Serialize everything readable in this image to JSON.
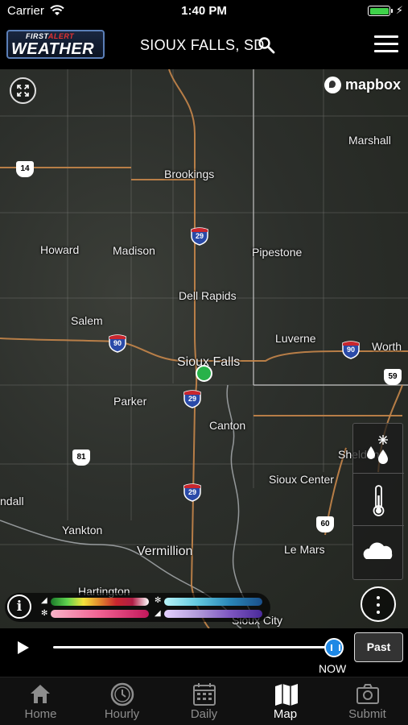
{
  "status": {
    "carrier": "Carrier",
    "time": "1:40 PM"
  },
  "header": {
    "logo_top_first": "FIRST",
    "logo_top_alert": "ALERT",
    "logo_main": "WEATHER",
    "location": "SIOUX FALLS, SD",
    "search_icon": "search-icon",
    "menu_icon": "hamburger-menu-icon"
  },
  "map": {
    "attribution": "mapbox",
    "fullscreen_icon": "fullscreen-icon",
    "cities": {
      "marshall": "Marshall",
      "brookings": "Brookings",
      "howard": "Howard",
      "madison": "Madison",
      "pipestone": "Pipestone",
      "dell_rapids": "Dell Rapids",
      "salem": "Salem",
      "luverne": "Luverne",
      "worthington": "Worth",
      "sioux_falls": "Sioux Falls",
      "parker": "Parker",
      "canton": "Canton",
      "sheldon": "Sheldon",
      "sioux_center": "Sioux Center",
      "randall": "ndall",
      "yankton": "Yankton",
      "le_mars": "Le Mars",
      "vermillion": "Vermillion",
      "hartington": "Hartington",
      "sioux_city": "Sioux City"
    },
    "shields": {
      "us14": "14",
      "i29_a": "29",
      "i90_a": "90",
      "i90_b": "90",
      "us59": "59",
      "i29_b": "29",
      "us81": "81",
      "i29_c": "29",
      "us60": "60"
    }
  },
  "layers": [
    "precipitation-layer-icon",
    "temperature-layer-icon",
    "clouds-layer-icon"
  ],
  "legend": {
    "info_label": "i",
    "colors": {
      "rain": "#2e7d32",
      "snow": "#80deea",
      "mix": "#f06292",
      "ice": "#9575cd"
    }
  },
  "timeline": {
    "now_label": "NOW",
    "past_label": "Past",
    "progress": 1.0
  },
  "tabs": [
    {
      "label": "Home",
      "icon": "home-icon",
      "active": false
    },
    {
      "label": "Hourly",
      "icon": "clock-icon",
      "active": false
    },
    {
      "label": "Daily",
      "icon": "calendar-icon",
      "active": false
    },
    {
      "label": "Map",
      "icon": "map-icon",
      "active": true
    },
    {
      "label": "Submit",
      "icon": "camera-icon",
      "active": false
    }
  ]
}
